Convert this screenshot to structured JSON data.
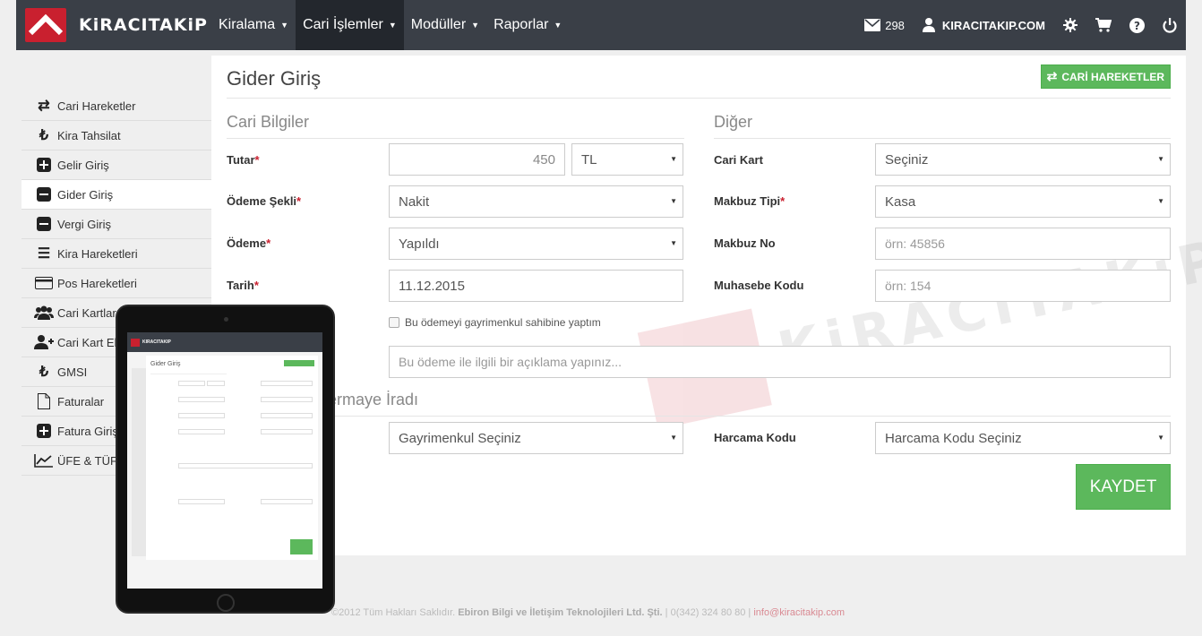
{
  "navbar": {
    "brand": "KiRACITAKiP",
    "menu": [
      {
        "label": "Kiralama",
        "active": false
      },
      {
        "label": "Cari İşlemler",
        "active": true
      },
      {
        "label": "Modüller",
        "active": false
      },
      {
        "label": "Raporlar",
        "active": false
      }
    ],
    "mail_count": "298",
    "site": "KIRACITAKIP.COM"
  },
  "sidebar": {
    "items": [
      {
        "label": "Cari Hareketler",
        "icon": "exchange-icon"
      },
      {
        "label": "Kira Tahsilat",
        "icon": "lira-icon"
      },
      {
        "label": "Gelir Giriş",
        "icon": "plus-square-icon"
      },
      {
        "label": "Gider Giriş",
        "icon": "minus-square-icon",
        "active": true
      },
      {
        "label": "Vergi Giriş",
        "icon": "minus-square-icon"
      },
      {
        "label": "Kira Hareketleri",
        "icon": "list-icon"
      },
      {
        "label": "Pos Hareketleri",
        "icon": "credit-card-icon"
      },
      {
        "label": "Cari Kartlar",
        "icon": "users-icon"
      },
      {
        "label": "Cari Kart Ekle",
        "icon": "user-plus-icon"
      },
      {
        "label": "GMSI",
        "icon": "lira-icon"
      },
      {
        "label": "Faturalar",
        "icon": "file-icon"
      },
      {
        "label": "Fatura Giriş",
        "icon": "plus-square-icon"
      },
      {
        "label": "ÜFE & TÜFE",
        "icon": "line-chart-icon"
      }
    ]
  },
  "page": {
    "title": "Gider Giriş",
    "cari_button": "CARİ HAREKETLER",
    "save_button": "KAYDET"
  },
  "form": {
    "cari_section": "Cari Bilgiler",
    "diger_section": "Diğer",
    "gmsi_section": "ermaye İradı",
    "tutar_label": "Tutar",
    "tutar_value": "450",
    "currency": "TL",
    "odeme_sekli_label": "Ödeme Şekli",
    "odeme_sekli_value": "Nakit",
    "odeme_label": "Ödeme",
    "odeme_value": "Yapıldı",
    "tarih_label": "Tarih",
    "tarih_value": "11.12.2015",
    "checkbox_label": "Bu ödemeyi gayrimenkul sahibine yaptım",
    "aciklama_placeholder": "Bu ödeme ile ilgili bir açıklama yapınız...",
    "cari_kart_label": "Cari Kart",
    "cari_kart_value": "Seçiniz",
    "makbuz_tipi_label": "Makbuz Tipi",
    "makbuz_tipi_value": "Kasa",
    "makbuz_no_label": "Makbuz No",
    "makbuz_no_placeholder": "örn: 45856",
    "muhasebe_label": "Muhasebe Kodu",
    "muhasebe_placeholder": "örn: 154",
    "gayrimenkul_value": "Gayrimenkul Seçiniz",
    "harcama_label": "Harcama Kodu",
    "harcama_value": "Harcama Kodu Seçiniz"
  },
  "watermark": "KiRACITAKiP",
  "footer": {
    "copyright": "©2012 Tüm Hakları Saklıdır.",
    "company": "Ebiron Bilgi ve İletişim Teknolojileri Ltd. Şti.",
    "phone": "| 0(342) 324 80 80 |",
    "email": "info@kiracitakip.com"
  },
  "tablet": {
    "brand": "KIRACITAKIP",
    "title": "Gider Giriş"
  },
  "colors": {
    "accent": "#c9202f",
    "navbar": "#3a3f47",
    "success": "#5cb85c"
  }
}
